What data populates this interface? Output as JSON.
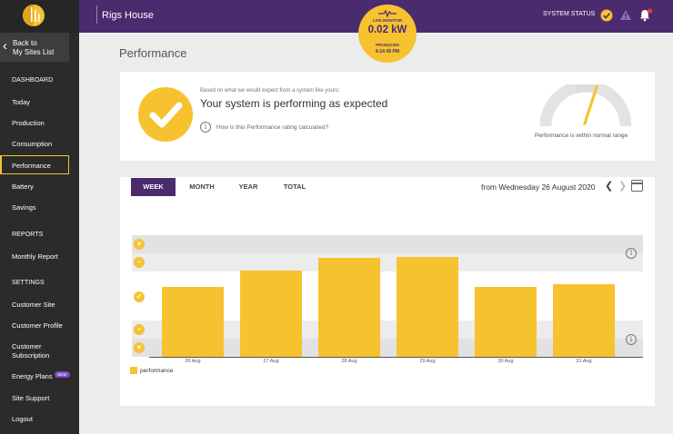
{
  "sidebar": {
    "back_label": "Back to\nMy Sites List",
    "sections": {
      "dashboard": "DASHBOARD",
      "reports": "REPORTS",
      "settings": "SETTINGS"
    },
    "items": {
      "today": "Today",
      "production": "Production",
      "consumption": "Consumption",
      "performance": "Performance",
      "battery": "Battery",
      "savings": "Savings",
      "monthly_report": "Monthly Report",
      "customer_site": "Customer Site",
      "customer_profile": "Customer Profile",
      "customer_subscription": "Customer\nSubscription",
      "energy_plans": "Energy Plans",
      "site_support": "Site Support",
      "logout": "Logout"
    },
    "new_badge": "NEW",
    "active_item": "Performance"
  },
  "header": {
    "site_name": "Rigs House",
    "system_status_label": "SYSTEM STATUS",
    "live_monitor": {
      "label": "LIVE MONITOR",
      "value": "0.02 kW",
      "produced_label": "PRODUCED",
      "time": "6:14:45 PM"
    },
    "icons": [
      "logo-icon",
      "check-circle-icon",
      "warning-icon",
      "bell-icon"
    ],
    "brand_color": "#4a2b6e",
    "accent_color": "#f7c230"
  },
  "page": {
    "title": "Performance"
  },
  "summary": {
    "basis": "Based on what we would expect from a system like yours:",
    "headline": "Your system is performing as expected",
    "how_link": "How is this Performance rating calculated?",
    "gauge_label": "Performance is within normal range"
  },
  "chart_panel": {
    "tabs": [
      "WEEK",
      "MONTH",
      "YEAR",
      "TOTAL"
    ],
    "active_tab": "WEEK",
    "date_label": "from Wednesday 26 August 2020"
  },
  "chart_data": {
    "type": "bar",
    "categories": [
      "26 Aug",
      "27 Aug",
      "28 Aug",
      "29 Aug",
      "30 Aug",
      "31 Aug"
    ],
    "values": [
      0.5,
      0.62,
      0.71,
      0.72,
      0.5,
      0.52
    ],
    "ylim": [
      0,
      1
    ],
    "bands": [
      "far-below",
      "below",
      "normal",
      "above",
      "far-above"
    ],
    "legend": [
      "performance"
    ],
    "legend_position": "bottom-left",
    "bar_color": "#f7c230"
  }
}
